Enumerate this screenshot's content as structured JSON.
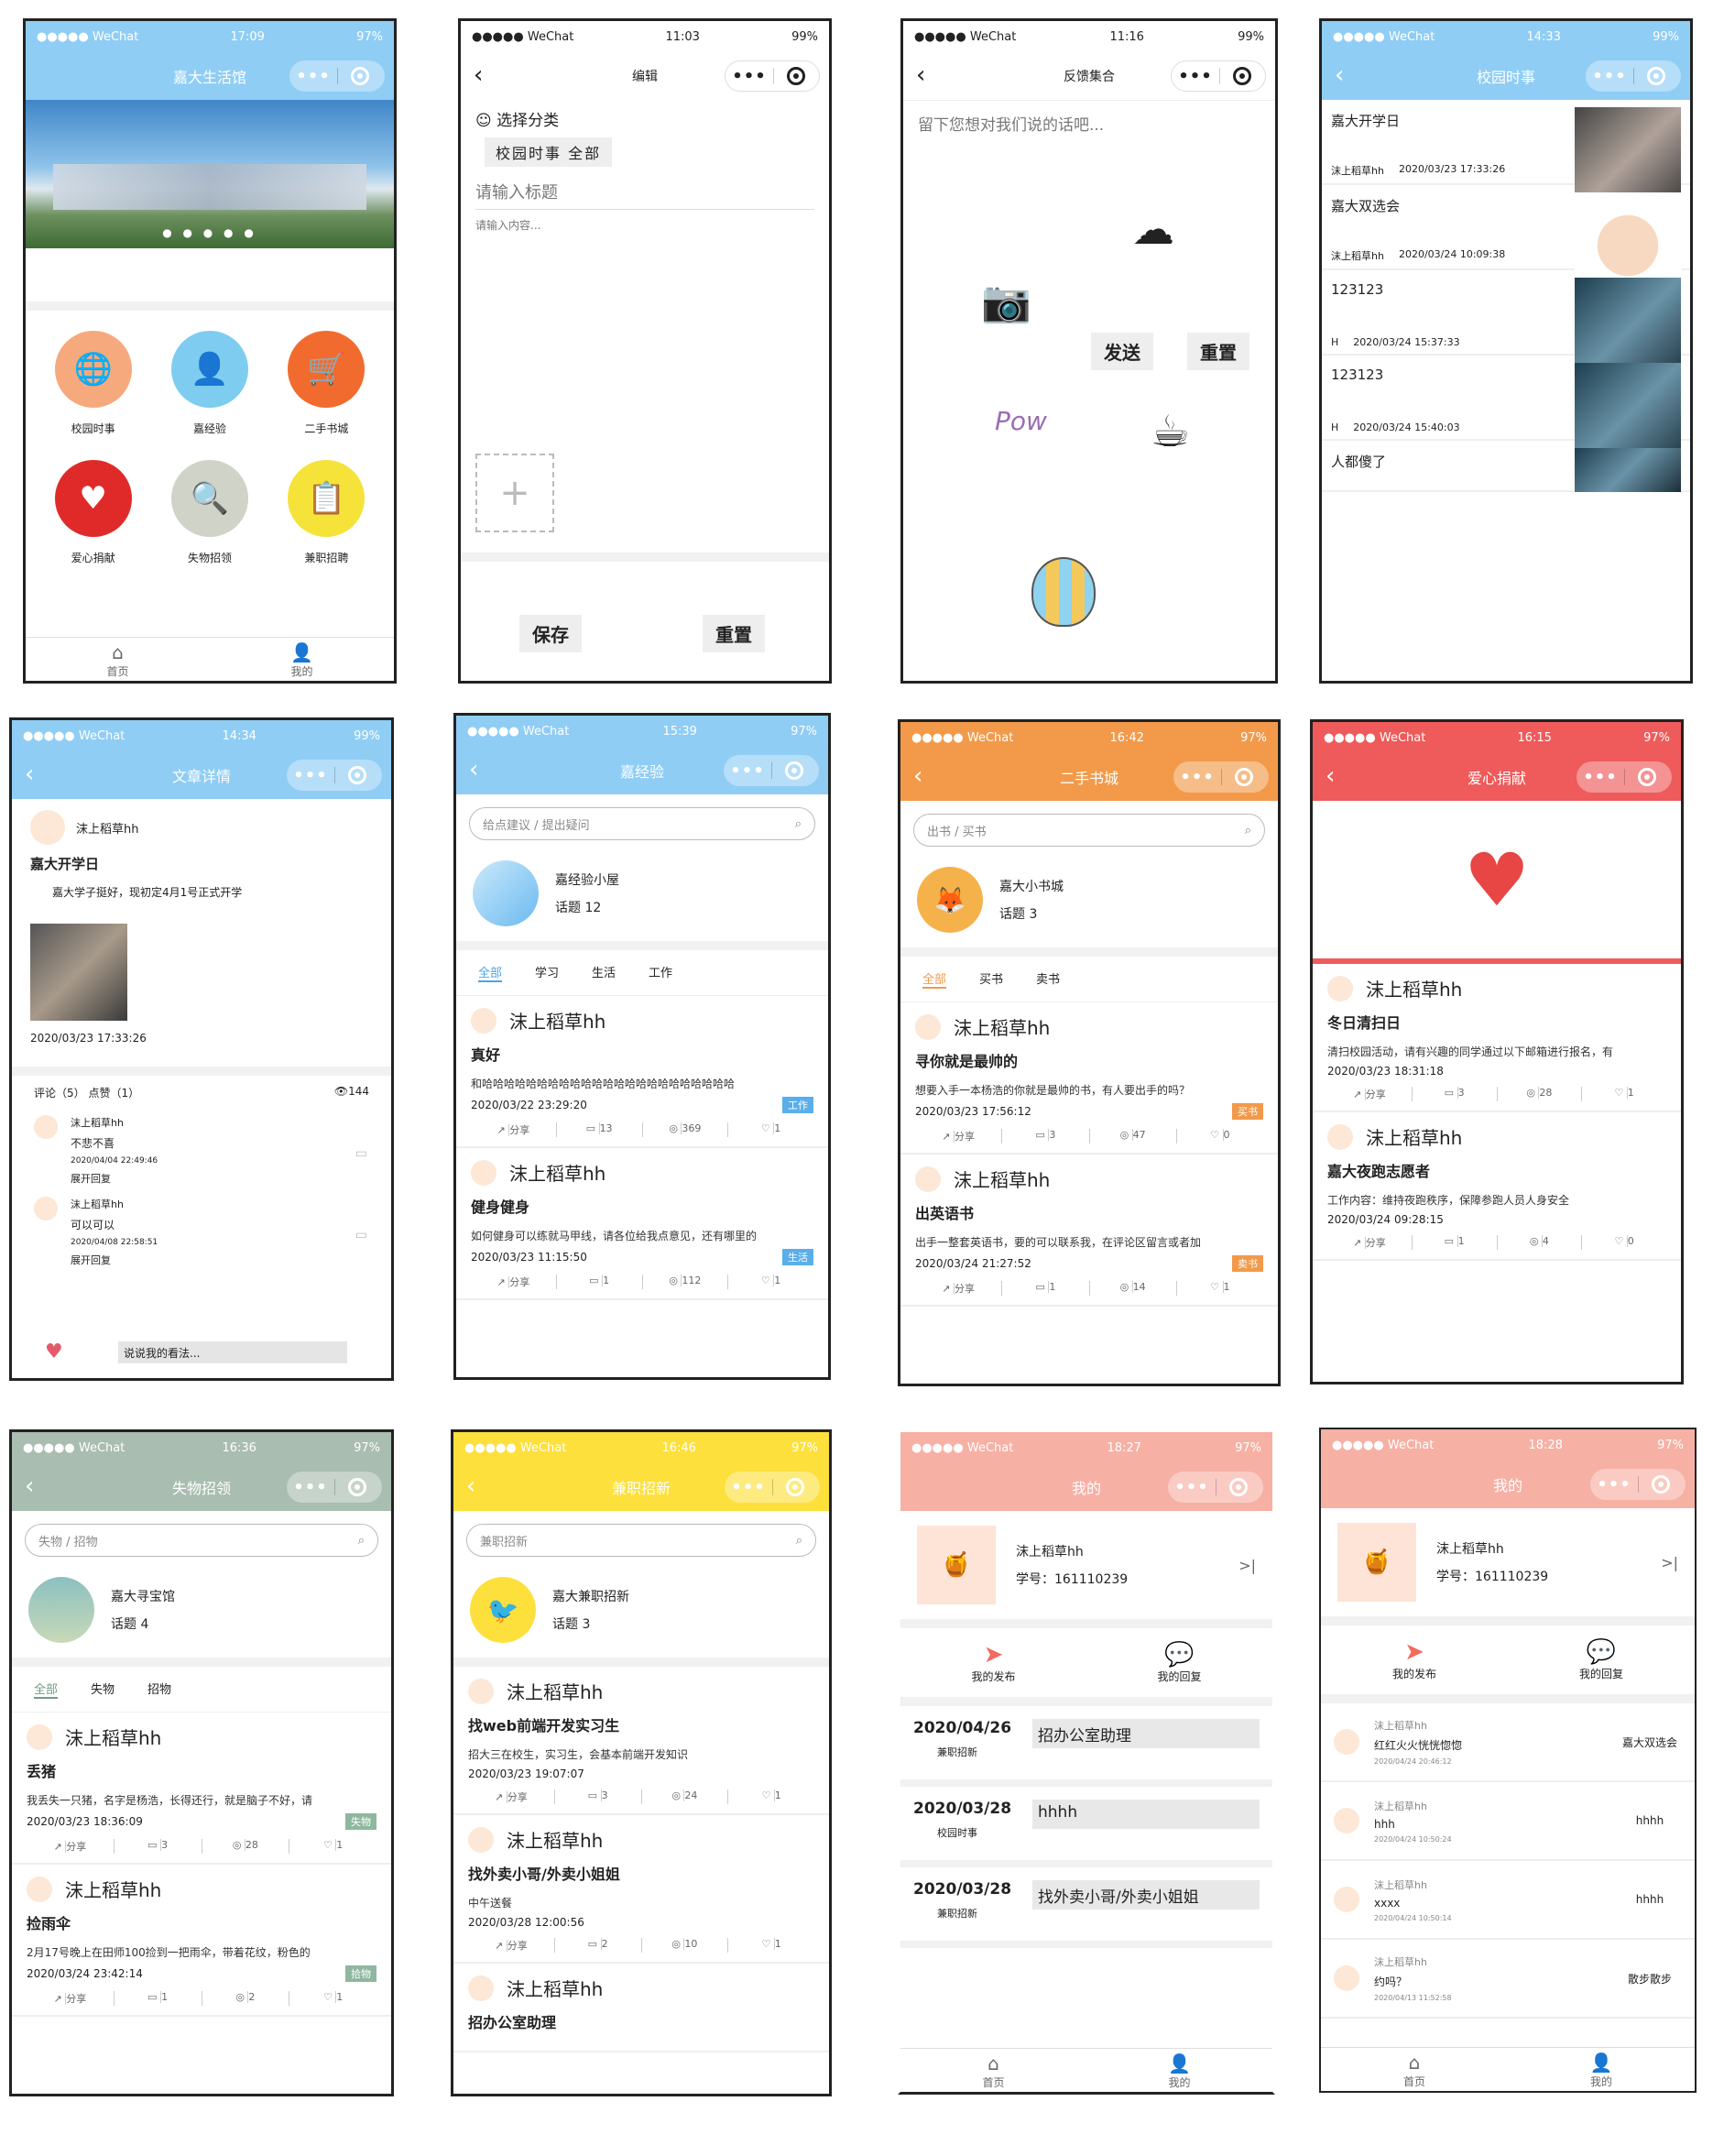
{
  "status": {
    "carrier": "●●●●● WeChat",
    "battery1": "97%",
    "battery2": "99%"
  },
  "s1": {
    "time": "17:09",
    "title": "嘉大生活馆",
    "icons": [
      {
        "label": "校园时事",
        "color": "#f7a97e",
        "glyph": "🌐"
      },
      {
        "label": "嘉经验",
        "color": "#7ecdf0",
        "glyph": "👤"
      },
      {
        "label": "二手书城",
        "color": "#f26b2e",
        "glyph": "🛒"
      },
      {
        "label": "爱心捐献",
        "color": "#e02a2a",
        "glyph": "♥"
      },
      {
        "label": "失物招领",
        "color": "#cfd3c8",
        "glyph": "🔍"
      },
      {
        "label": "兼职招聘",
        "color": "#f5e33a",
        "glyph": "📋"
      }
    ],
    "nav_home": "首页",
    "nav_me": "我的"
  },
  "s2": {
    "time": "11:03",
    "title": "编辑",
    "cat_label": "选择分类",
    "cat_value": "校园时事 全部",
    "title_ph": "请输入标题",
    "content_ph": "请输入内容...",
    "save": "保存",
    "reset": "重置"
  },
  "s3": {
    "time": "11:16",
    "title": "反馈集合",
    "placeholder": "留下您想对我们说的话吧...",
    "send": "发送",
    "reset": "重置"
  },
  "s4": {
    "time": "14:33",
    "title": "校园时事",
    "items": [
      {
        "title": "嘉大开学日",
        "user": "沫上稻草hh",
        "date": "2020/03/23 17:33:26"
      },
      {
        "title": "嘉大双选会",
        "user": "沫上稻草hh",
        "date": "2020/03/24 10:09:38"
      },
      {
        "title": "123123",
        "user": "H",
        "date": "2020/03/24 15:37:33"
      },
      {
        "title": "123123",
        "user": "H",
        "date": "2020/03/24 15:40:03"
      },
      {
        "title": "人都傻了",
        "user": "",
        "date": ""
      }
    ]
  },
  "s5": {
    "time": "14:34",
    "title": "文章详情",
    "user": "沫上稻草hh",
    "art_title": "嘉大开学日",
    "art_body": "嘉大学子挺好，现初定4月1号正式开学",
    "date": "2020/03/23 17:33:26",
    "stats": "评论（5） 点赞（1）",
    "views": "144",
    "comments": [
      {
        "user": "沫上稻草hh",
        "text": "不悲不喜",
        "date": "2020/04/04 22:49:46",
        "expand": "展开回复"
      },
      {
        "user": "沫上稻草hh",
        "text": "可以可以",
        "date": "2020/04/08 22:58:51",
        "expand": "展开回复"
      }
    ],
    "input_ph": "说说我的看法..."
  },
  "s6": {
    "time": "15:39",
    "title": "嘉经验",
    "search": "给点建议 / 提出疑问",
    "group": "嘉经验小屋",
    "topics": "话题 12",
    "tabs": [
      "全部",
      "学习",
      "生活",
      "工作"
    ],
    "posts": [
      {
        "user": "沫上稻草hh",
        "title": "真好",
        "content": "和哈哈哈哈哈哈哈哈哈哈哈哈哈哈哈哈哈哈哈哈哈哈哈",
        "date": "2020/03/22 23:29:20",
        "tag": "工作",
        "share": "分享",
        "c": "13",
        "v": "369",
        "l": "1"
      },
      {
        "user": "沫上稻草hh",
        "title": "健身健身",
        "content": "如何健身可以练就马甲线，请各位给我点意见，还有哪里的",
        "date": "2020/03/23 11:15:50",
        "tag": "生活",
        "share": "分享",
        "c": "1",
        "v": "112",
        "l": "1"
      }
    ]
  },
  "s7": {
    "time": "16:42",
    "title": "二手书城",
    "search": "出书 / 买书",
    "group": "嘉大小书城",
    "topics": "话题 3",
    "tabs": [
      "全部",
      "买书",
      "卖书"
    ],
    "posts": [
      {
        "user": "沫上稻草hh",
        "title": "寻你就是最帅的",
        "content": "想要入手一本杨浩的你就是最帅的书，有人要出手的吗？",
        "date": "2020/03/23 17:56:12",
        "tag": "买书",
        "share": "分享",
        "c": "3",
        "v": "47",
        "l": "0"
      },
      {
        "user": "沫上稻草hh",
        "title": "出英语书",
        "content": "出手一整套英语书，要的可以联系我，在评论区留言或者加",
        "date": "2020/03/24 21:27:52",
        "tag": "卖书",
        "share": "分享",
        "c": "1",
        "v": "14",
        "l": "1"
      }
    ]
  },
  "s8": {
    "time": "16:15",
    "title": "爱心捐献",
    "posts": [
      {
        "user": "沫上稻草hh",
        "title": "冬日清扫日",
        "content": "清扫校园活动，请有兴趣的同学通过以下邮箱进行报名，有",
        "date": "2020/03/23 18:31:18",
        "share": "分享",
        "c": "3",
        "v": "28",
        "l": "1"
      },
      {
        "user": "沫上稻草hh",
        "title": "嘉大夜跑志愿者",
        "content": "工作内容：维持夜跑秩序，保障参跑人员人身安全",
        "date": "2020/03/24 09:28:15",
        "share": "分享",
        "c": "1",
        "v": "4",
        "l": "0"
      }
    ]
  },
  "s9": {
    "time": "16:36",
    "title": "失物招领",
    "search": "失物 / 招物",
    "group": "嘉大寻宝馆",
    "topics": "话题 4",
    "tabs": [
      "全部",
      "失物",
      "招物"
    ],
    "posts": [
      {
        "user": "沫上稻草hh",
        "title": "丢猪",
        "content": "我丢失一只猪，名字是杨浩，长得还行，就是脑子不好，请",
        "date": "2020/03/23 18:36:09",
        "tag": "失物",
        "share": "分享",
        "c": "3",
        "v": "28",
        "l": "1"
      },
      {
        "user": "沫上稻草hh",
        "title": "捡雨伞",
        "content": "2月17号晚上在田师100捡到一把雨伞，带着花纹，粉色的",
        "date": "2020/03/24 23:42:14",
        "tag": "拾物",
        "share": "分享",
        "c": "1",
        "v": "2",
        "l": "1"
      }
    ]
  },
  "s10": {
    "time": "16:46",
    "title": "兼职招新",
    "search": "兼职招新",
    "group": "嘉大兼职招新",
    "topics": "话题 3",
    "posts": [
      {
        "user": "沫上稻草hh",
        "title": "找web前端开发实习生",
        "content": "招大三在校生，实习生，会基本前端开发知识",
        "date": "2020/03/23 19:07:07",
        "share": "分享",
        "c": "3",
        "v": "24",
        "l": "1"
      },
      {
        "user": "沫上稻草hh",
        "title": "找外卖小哥/外卖小姐姐",
        "content": "中午送餐",
        "date": "2020/03/28 12:00:56",
        "share": "分享",
        "c": "2",
        "v": "10",
        "l": "1"
      },
      {
        "user": "沫上稻草hh",
        "title": "招办公室助理",
        "content": "",
        "date": "",
        "share": "",
        "c": "",
        "v": "",
        "l": ""
      }
    ]
  },
  "s11": {
    "time": "18:27",
    "title": "我的",
    "name": "沫上稻草hh",
    "sid": "学号：161110239",
    "pub": "我的发布",
    "reply": "我的回复",
    "items": [
      {
        "date": "2020/04/26",
        "cat": "兼职招新",
        "title": "招办公室助理"
      },
      {
        "date": "2020/03/28",
        "cat": "校园时事",
        "title": "hhhh"
      },
      {
        "date": "2020/03/28",
        "cat": "兼职招新",
        "title": "找外卖小哥/外卖小姐姐"
      }
    ],
    "nav_home": "首页",
    "nav_me": "我的"
  },
  "s12": {
    "time": "18:28",
    "title": "我的",
    "name": "沫上稻草hh",
    "sid": "学号：161110239",
    "pub": "我的发布",
    "reply": "我的回复",
    "items": [
      {
        "user": "沫上稻草hh",
        "text": "红红火火恍恍惚惚",
        "date": "2020/04/24 20:46:12",
        "ref": "嘉大双选会"
      },
      {
        "user": "沫上稻草hh",
        "text": "hhh",
        "date": "2020/04/24 10:50:24",
        "ref": "hhhh"
      },
      {
        "user": "沫上稻草hh",
        "text": "xxxx",
        "date": "2020/04/24 10:50:14",
        "ref": "hhhh"
      },
      {
        "user": "沫上稻草hh",
        "text": "约吗？",
        "date": "2020/04/13 11:52:58",
        "ref": "散步散步"
      }
    ],
    "nav_home": "首页",
    "nav_me": "我的"
  },
  "colors": {
    "blue": "#8fcdf5",
    "orange": "#f29a4a",
    "red": "#ef5a5a",
    "sage": "#a9bdb0",
    "yellow": "#fde03c",
    "pink": "#f7b0a4"
  }
}
